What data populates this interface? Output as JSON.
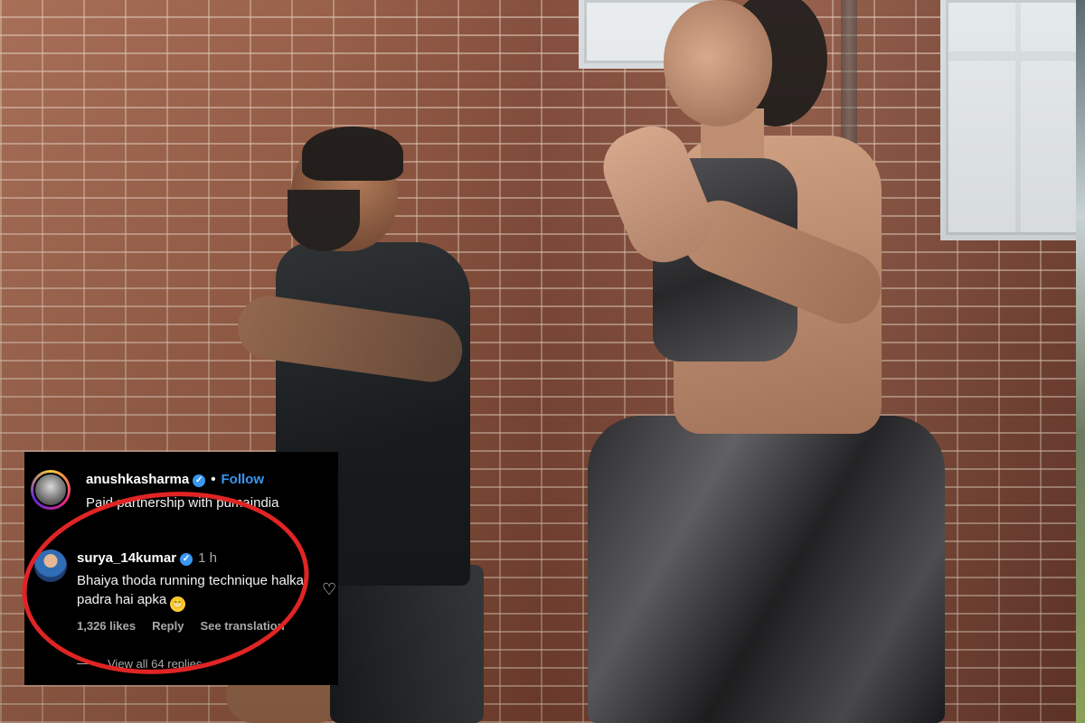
{
  "photo": {
    "alt_subjects": [
      "man-running",
      "woman-running"
    ]
  },
  "instagram": {
    "post": {
      "username": "anushkasharma",
      "verified_mark": "✓",
      "dot": "•",
      "follow_label": "Follow",
      "caption": "Paid partnership with pumaindia"
    },
    "comment": {
      "username": "surya_14kumar",
      "verified_mark": "✓",
      "time": "1 h",
      "text": "Bhaiya thoda running technique halka padra hai apka",
      "emoji": "😁",
      "likes": "1,326 likes",
      "reply_label": "Reply",
      "translate_label": "See translation"
    },
    "view_all_label": "View all 64 replies"
  },
  "icons": {
    "heart": "♡"
  },
  "colors": {
    "link_blue": "#3897f0",
    "highlight_red": "#e02424",
    "card_bg": "#000000"
  }
}
